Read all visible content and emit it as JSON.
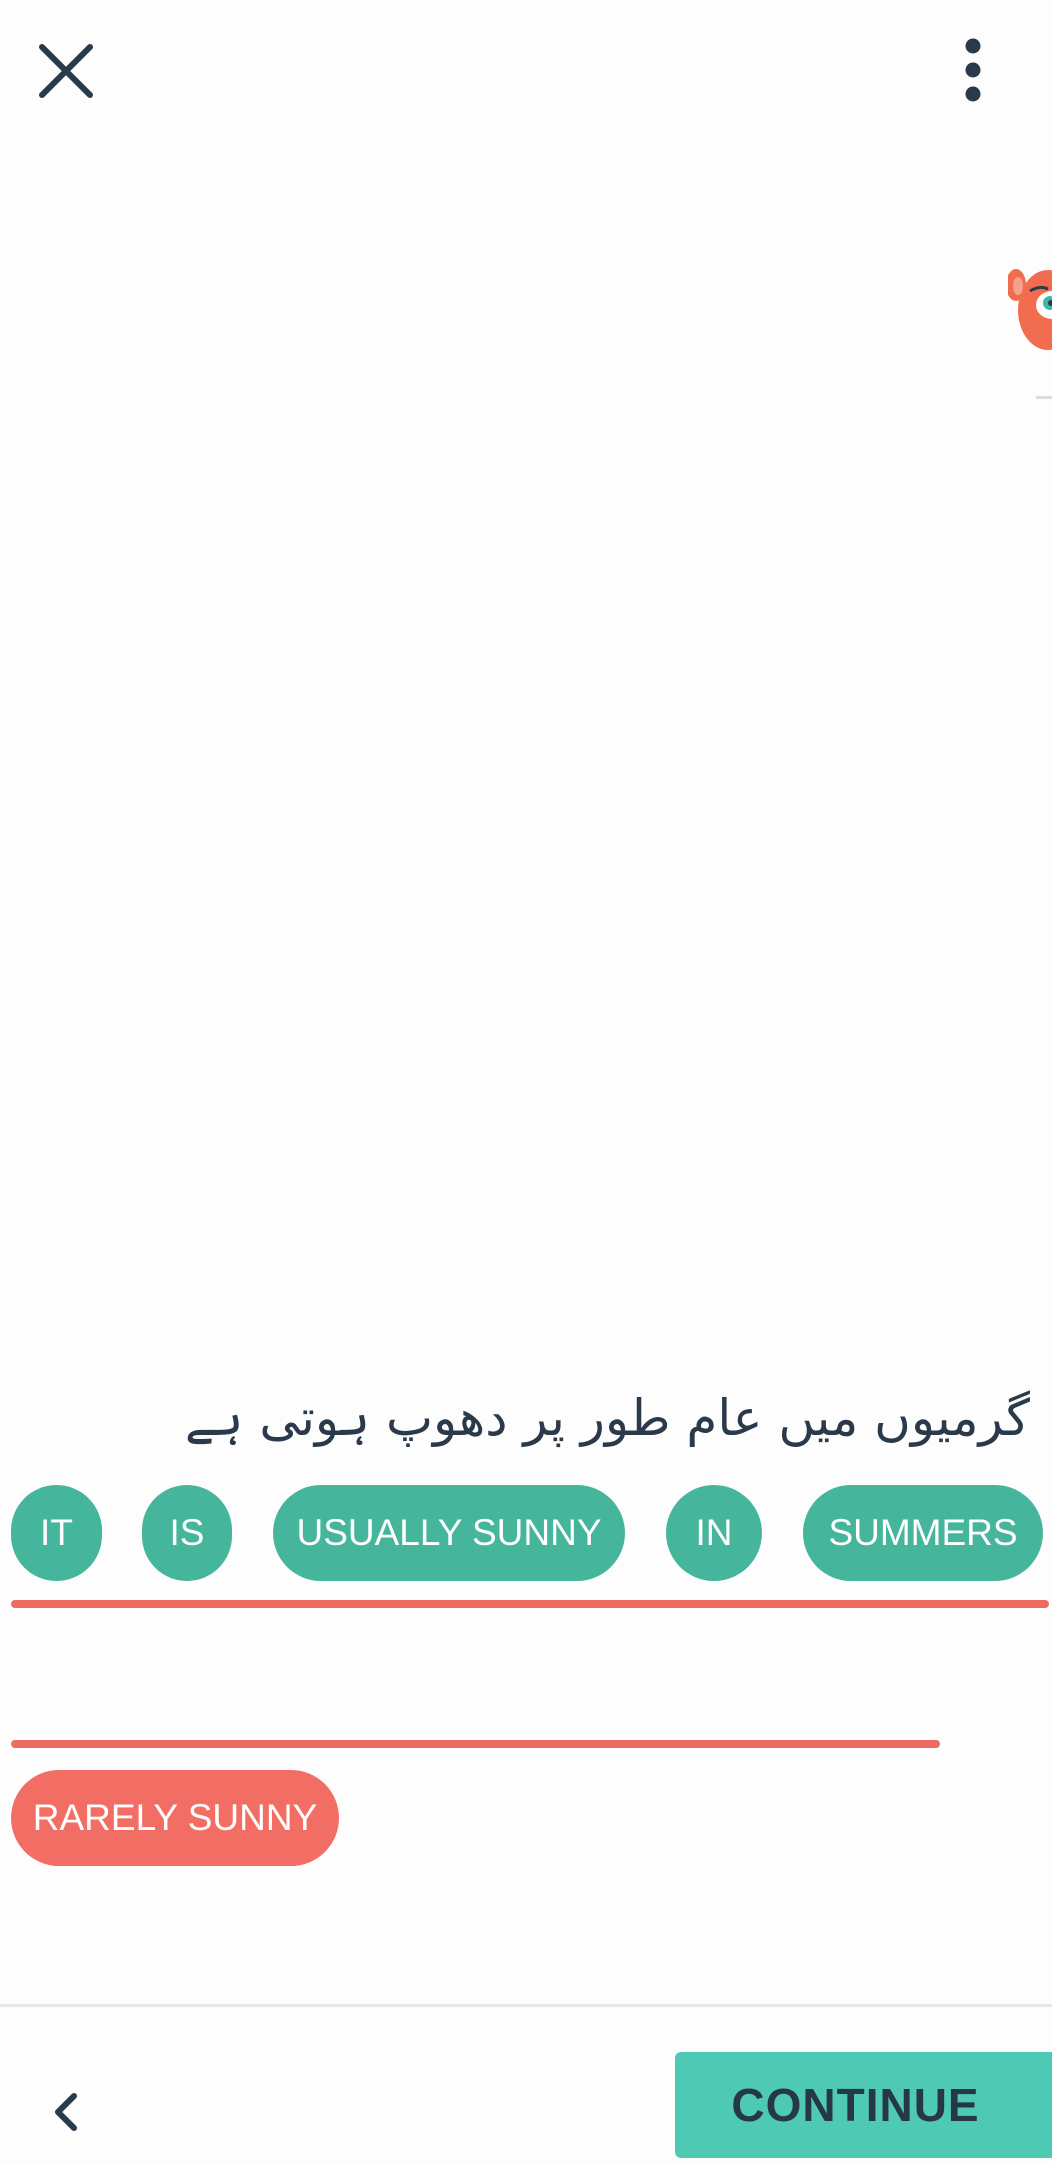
{
  "header": {
    "close_icon": "close-icon",
    "more_icon": "more-vertical-icon"
  },
  "mascot": {
    "icon": "monkey-mascot-icon"
  },
  "prompt": {
    "text": "گرمیوں میں عام طور پر دھوپ ہوتی ہے"
  },
  "answer": {
    "words": [
      {
        "label": "IT"
      },
      {
        "label": "IS"
      },
      {
        "label": "USUALLY SUNNY"
      },
      {
        "label": "IN"
      },
      {
        "label": "SUMMERS"
      }
    ]
  },
  "options": {
    "words": [
      {
        "label": "RARELY SUNNY"
      }
    ]
  },
  "footer": {
    "back_icon": "chevron-left-icon",
    "continue_label": "CONTINUE"
  },
  "colors": {
    "chip_green": "#45b69c",
    "chip_red": "#f26d63",
    "accent_line": "#ee6b63",
    "continue_bg": "#4ecab4",
    "text_dark": "#2b3a4a"
  }
}
